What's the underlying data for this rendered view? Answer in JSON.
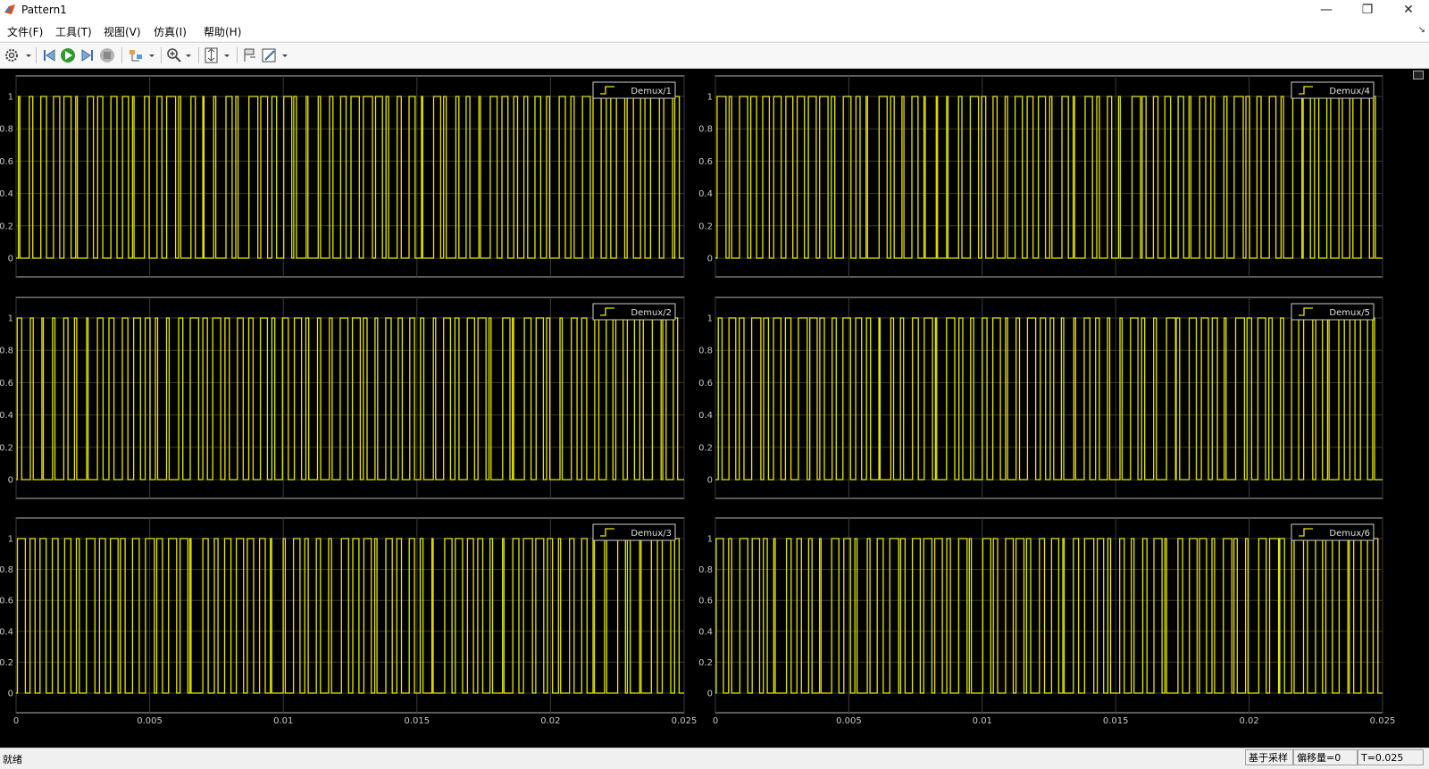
{
  "window": {
    "title": "Pattern1",
    "min_glyph": "—",
    "restore_glyph": "❐",
    "close_glyph": "✕"
  },
  "menu": [
    {
      "id": "file",
      "label": "文件(F)"
    },
    {
      "id": "tools",
      "label": "工具(T)"
    },
    {
      "id": "view",
      "label": "视图(V)"
    },
    {
      "id": "simulation",
      "label": "仿真(I)"
    },
    {
      "id": "help",
      "label": "帮助(H)"
    }
  ],
  "menu_corner_glyph": "↘",
  "toolbar": {
    "buttons": [
      "settings-icon",
      "step-back-icon",
      "run-icon",
      "step-forward-icon",
      "stop-icon",
      "highlight-icon",
      "zoom-in-icon",
      "scale-axes-icon",
      "cursor-icon",
      "style-icon"
    ]
  },
  "colors": {
    "signal": "#e6e600",
    "axes_bg": "#000000",
    "grid": "#3a3a3a",
    "frame": "#b3b3b3",
    "tick_text": "#c8c8c8"
  },
  "status": {
    "ready": "就绪",
    "sample_based": "基于采样",
    "offset": "偏移量=0",
    "time": "T=0.025"
  },
  "plots": [
    {
      "legend": "Demux/1",
      "seed": 11
    },
    {
      "legend": "Demux/2",
      "seed": 23
    },
    {
      "legend": "Demux/3",
      "seed": 37
    },
    {
      "legend": "Demux/4",
      "seed": 41
    },
    {
      "legend": "Demux/5",
      "seed": 53
    },
    {
      "legend": "Demux/6",
      "seed": 67
    }
  ],
  "chart_data": [
    {
      "type": "line",
      "series": [
        {
          "name": "Demux/1"
        }
      ],
      "xlim": [
        0,
        0.025
      ],
      "ylim": [
        0,
        1
      ],
      "x_ticks": [
        "0",
        "0.005",
        "0.01",
        "0.015",
        "0.02",
        "0.025"
      ],
      "y_ticks": [
        "0",
        "0.2",
        "0.4",
        "0.6",
        "0.8",
        "1"
      ],
      "grid": true,
      "legend_position": "top-right"
    },
    {
      "type": "line",
      "series": [
        {
          "name": "Demux/2"
        }
      ],
      "xlim": [
        0,
        0.025
      ],
      "ylim": [
        0,
        1
      ],
      "x_ticks": [
        "0",
        "0.005",
        "0.01",
        "0.015",
        "0.02",
        "0.025"
      ],
      "y_ticks": [
        "0",
        "0.2",
        "0.4",
        "0.6",
        "0.8",
        "1"
      ],
      "grid": true,
      "legend_position": "top-right"
    },
    {
      "type": "line",
      "series": [
        {
          "name": "Demux/3"
        }
      ],
      "xlim": [
        0,
        0.025
      ],
      "ylim": [
        0,
        1
      ],
      "x_ticks": [
        "0",
        "0.005",
        "0.01",
        "0.015",
        "0.02",
        "0.025"
      ],
      "y_ticks": [
        "0",
        "0.2",
        "0.4",
        "0.6",
        "0.8",
        "1"
      ],
      "grid": true,
      "legend_position": "top-right"
    },
    {
      "type": "line",
      "series": [
        {
          "name": "Demux/4"
        }
      ],
      "xlim": [
        0,
        0.025
      ],
      "ylim": [
        0,
        1
      ],
      "x_ticks": [
        "0",
        "0.005",
        "0.01",
        "0.015",
        "0.02",
        "0.025"
      ],
      "y_ticks": [
        "0",
        "0.2",
        "0.4",
        "0.6",
        "0.8",
        "1"
      ],
      "grid": true,
      "legend_position": "top-right"
    },
    {
      "type": "line",
      "series": [
        {
          "name": "Demux/5"
        }
      ],
      "xlim": [
        0,
        0.025
      ],
      "ylim": [
        0,
        1
      ],
      "x_ticks": [
        "0",
        "0.005",
        "0.01",
        "0.015",
        "0.02",
        "0.025"
      ],
      "y_ticks": [
        "0",
        "0.2",
        "0.4",
        "0.6",
        "0.8",
        "1"
      ],
      "grid": true,
      "legend_position": "top-right"
    },
    {
      "type": "line",
      "series": [
        {
          "name": "Demux/6"
        }
      ],
      "xlim": [
        0,
        0.025
      ],
      "ylim": [
        0,
        1
      ],
      "x_ticks": [
        "0",
        "0.005",
        "0.01",
        "0.015",
        "0.02",
        "0.025"
      ],
      "y_ticks": [
        "0",
        "0.2",
        "0.4",
        "0.6",
        "0.8",
        "1"
      ],
      "grid": true,
      "legend_position": "top-right"
    }
  ]
}
